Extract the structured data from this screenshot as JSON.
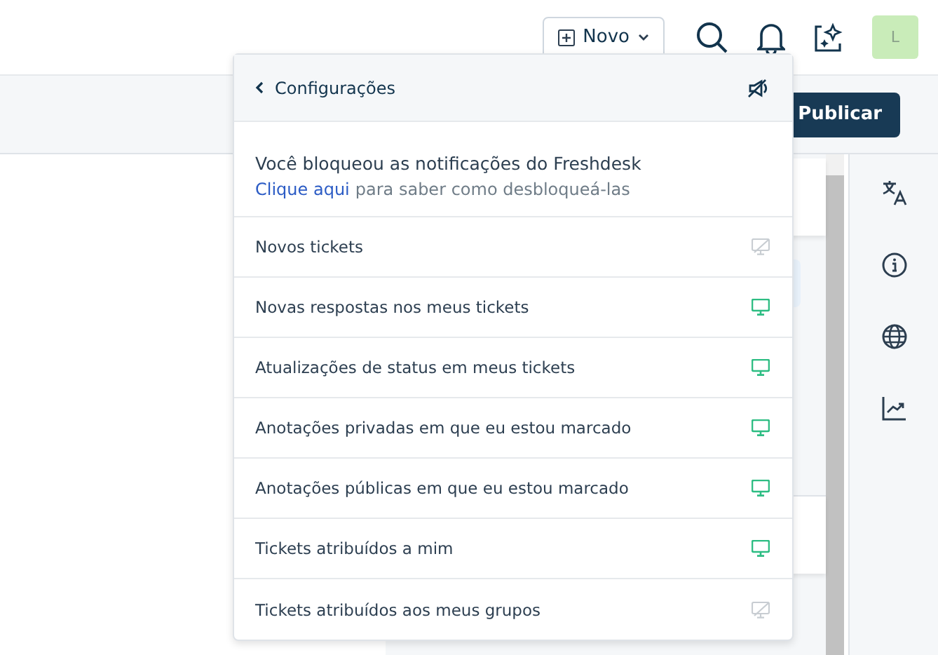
{
  "topbar": {
    "new_button": "Novo",
    "avatar": "L"
  },
  "toolbar": {
    "publish_button": "Publicar"
  },
  "popup": {
    "back_label": "Configurações",
    "message": "Você bloqueou as notificações do Freshdesk",
    "help_link": "Clique aqui",
    "help_text": "para saber como desbloqueá-las",
    "rows": [
      {
        "label": "Novos tickets",
        "enabled": false
      },
      {
        "label": "Novas respostas nos meus tickets",
        "enabled": true
      },
      {
        "label": "Atualizações de status em meus tickets",
        "enabled": true
      },
      {
        "label": "Anotações privadas em que eu estou marcado",
        "enabled": true
      },
      {
        "label": "Anotações públicas em que eu estou marcado",
        "enabled": true
      },
      {
        "label": "Tickets atribuídos a mim",
        "enabled": true
      },
      {
        "label": "Tickets atribuídos aos meus grupos",
        "enabled": false
      }
    ]
  }
}
